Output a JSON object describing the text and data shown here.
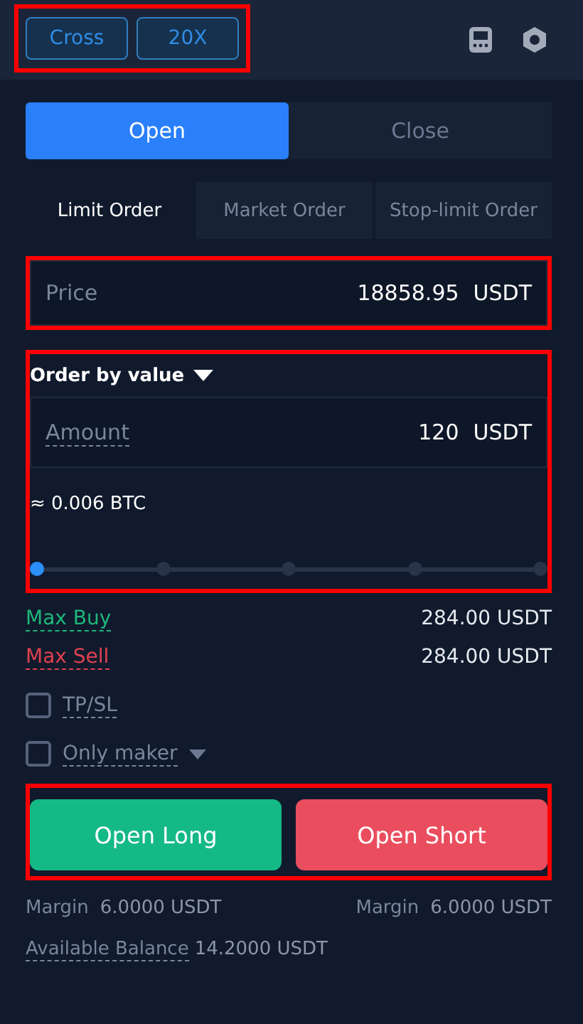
{
  "header": {
    "highlighted": true,
    "mode_buttons": [
      "Cross",
      "20X"
    ]
  },
  "side_tabs": [
    {
      "label": "Open",
      "selected": true
    },
    {
      "label": "Close",
      "selected": false
    }
  ],
  "order_types": [
    {
      "label": "Limit Order",
      "selected": true
    },
    {
      "label": "Market Order",
      "selected": false
    },
    {
      "label": "Stop-limit Order",
      "selected": false
    }
  ],
  "price_field": {
    "highlighted": true,
    "placeholder": "Price",
    "value": "18858.95",
    "unit": "USDT"
  },
  "amount_section": {
    "highlighted": true,
    "mode": "Order by value",
    "placeholder": "Amount",
    "value": "120",
    "unit": "USDT",
    "conversion": "≈ 0.006 BTC",
    "level": 0
  },
  "limits": [
    {
      "label": "Max Buy",
      "value": "284.00 USDT",
      "color": "#1fb67c"
    },
    {
      "label": "Max Sell",
      "value": "284.00 USDT",
      "color": "#e0414f"
    }
  ],
  "options": [
    {
      "label": "TP/SL",
      "checked": false,
      "dropdown": false
    },
    {
      "label": "Only maker",
      "checked": false,
      "dropdown": true
    }
  ],
  "actions": {
    "highlighted": true,
    "buttons": [
      {
        "label": "Open Long",
        "kind": "long"
      },
      {
        "label": "Open Short",
        "kind": "short"
      }
    ]
  },
  "margins": [
    {
      "label": "Margin",
      "value": "6.0000 USDT"
    },
    {
      "label": "Margin",
      "value": "6.0000 USDT"
    }
  ],
  "balance": {
    "label": "Available Balance",
    "value": "14.2000 USDT"
  }
}
